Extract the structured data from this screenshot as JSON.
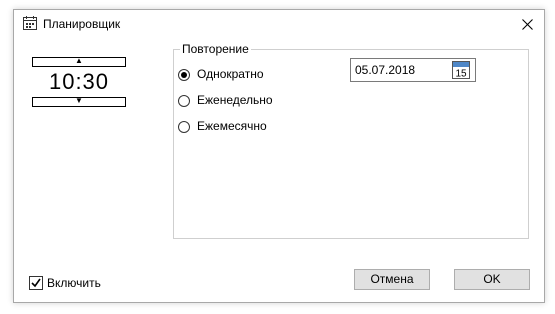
{
  "window": {
    "title": "Планировщик"
  },
  "time": {
    "value": "10:30",
    "up_arrow": "▲",
    "down_arrow": "▼"
  },
  "repeat": {
    "legend": "Повторение",
    "options": [
      {
        "label": "Однократно",
        "selected": true
      },
      {
        "label": "Еженедельно",
        "selected": false
      },
      {
        "label": "Ежемесячно",
        "selected": false
      }
    ],
    "date": "05.07.2018",
    "calendar_day": "15"
  },
  "enable": {
    "label": "Включить",
    "checked": true
  },
  "buttons": {
    "cancel": "Отмена",
    "ok": "OK"
  },
  "icons": {
    "title": "calendar-icon",
    "close": "close-icon",
    "date_picker": "calendar-icon"
  },
  "colors": {
    "calendar_header": "#4f87c7",
    "button_bg": "#e1e1e1",
    "button_border": "#adadad"
  }
}
